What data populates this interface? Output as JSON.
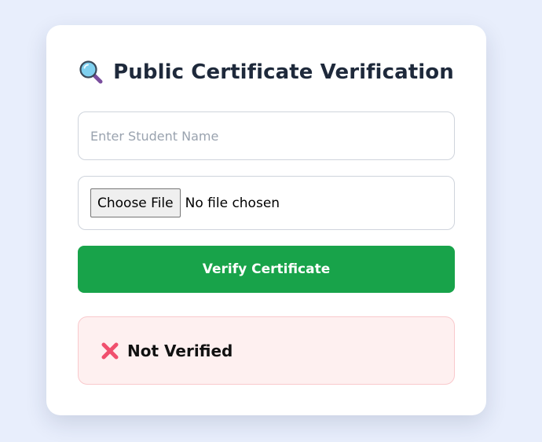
{
  "card": {
    "title": "Public Certificate Verification",
    "title_icon": "magnifying-glass-icon"
  },
  "form": {
    "student_name": {
      "placeholder": "Enter Student Name",
      "value": ""
    },
    "file": {
      "button_label": "Choose File",
      "status": "No file chosen"
    },
    "verify_label": "Verify Certificate"
  },
  "result": {
    "icon": "cross-mark-icon",
    "text": "Not Verified"
  },
  "colors": {
    "page_background": "#e8eefc",
    "card_background": "#ffffff",
    "title_text": "#1e293b",
    "verify_button": "#18a34a",
    "result_background": "#fef0f0",
    "result_border": "#f9c9cc",
    "cross_mark": "#f0506e"
  }
}
